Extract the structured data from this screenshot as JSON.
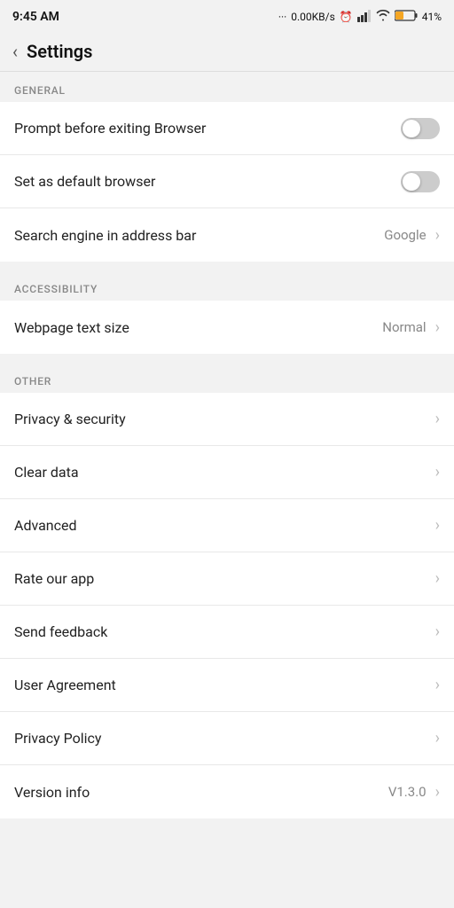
{
  "statusBar": {
    "time": "9:45 AM",
    "network": "0.00KB/s",
    "battery": "41%"
  },
  "header": {
    "back_label": "‹",
    "title": "Settings"
  },
  "sections": [
    {
      "name": "GENERAL",
      "items": [
        {
          "label": "Prompt before exiting Browser",
          "type": "toggle",
          "enabled": false
        },
        {
          "label": "Set as default browser",
          "type": "toggle",
          "enabled": false
        },
        {
          "label": "Search engine in address bar",
          "type": "value",
          "value": "Google"
        }
      ]
    },
    {
      "name": "ACCESSIBILITY",
      "items": [
        {
          "label": "Webpage text size",
          "type": "value",
          "value": "Normal"
        }
      ]
    },
    {
      "name": "OTHER",
      "items": [
        {
          "label": "Privacy & security",
          "type": "nav"
        },
        {
          "label": "Clear data",
          "type": "nav"
        },
        {
          "label": "Advanced",
          "type": "nav"
        },
        {
          "label": "Rate our app",
          "type": "nav"
        },
        {
          "label": "Send feedback",
          "type": "nav"
        },
        {
          "label": "User Agreement",
          "type": "nav"
        },
        {
          "label": "Privacy Policy",
          "type": "nav"
        },
        {
          "label": "Version info",
          "type": "value",
          "value": "V1.3.0"
        }
      ]
    }
  ]
}
